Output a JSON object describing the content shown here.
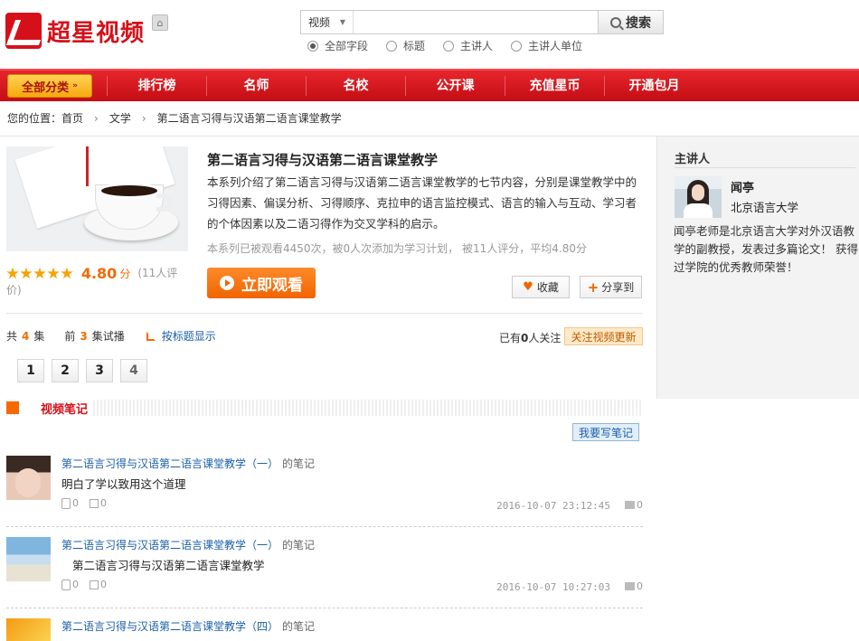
{
  "header": {
    "logo_text": "超星视频",
    "search": {
      "type": "视频",
      "placeholder": "",
      "button": "搜索",
      "filters": [
        "全部字段",
        "标题",
        "主讲人",
        "主讲人单位"
      ],
      "selected_filter": "全部字段"
    }
  },
  "nav": {
    "all": "全部分类",
    "items": [
      "排行榜",
      "名师",
      "名校",
      "公开课",
      "充值星币",
      "开通包月"
    ]
  },
  "breadcrumb": {
    "label": "您的位置：",
    "items": [
      "首页",
      "文学",
      "第二语言习得与汉语第二语言课堂教学"
    ]
  },
  "course": {
    "title": "第二语言习得与汉语第二语言课堂教学",
    "description": "本系列介绍了第二语言习得与汉语第二语言课堂教学的七节内容，分别是课堂教学中的习得因素、偏误分析、习得顺序、克拉申的语言监控模式、语言的输入与互动、学习者的个体因素以及二语习得作为交叉学科的启示。",
    "stats": "本系列已被观看4450次，被0人次添加为学习计划，  被11人评分，平均4.80分",
    "stars": 5,
    "score": "4.80",
    "score_unit": "分",
    "raters": "(11人评价)",
    "watch_button": "立即观看",
    "favorite": "收藏",
    "share": "分享到"
  },
  "episodes": {
    "total_prefix": "共",
    "total": "4",
    "total_suffix": "集",
    "trial_prefix": "前",
    "trial": "3",
    "trial_suffix": "集试播",
    "by_title": "按标题显示",
    "followers_prefix": "已有",
    "followers": "0",
    "followers_suffix": "人关注",
    "follow_button": "关注视频更新",
    "pages": [
      "1",
      "2",
      "3",
      "4"
    ],
    "current_page": "4"
  },
  "notes": {
    "title": "视频笔记",
    "write_button": "我要写笔记",
    "items": [
      {
        "link": "第二语言习得与汉语第二语言课堂教学（一）",
        "of": "的笔记",
        "body": "明白了学以致用这个道理",
        "likes": "0",
        "dislikes": "0",
        "time": "2016-10-07 23:12:45",
        "comments": "0"
      },
      {
        "link": "第二语言习得与汉语第二语言课堂教学（一）",
        "of": "的笔记",
        "body": "第二语言习得与汉语第二语言课堂教学",
        "likes": "0",
        "dislikes": "0",
        "time": "2016-10-07 10:27:03",
        "comments": "0"
      },
      {
        "link": "第二语言习得与汉语第二语言课堂教学（四）",
        "of": "的笔记",
        "body": ""
      }
    ]
  },
  "speaker": {
    "title": "主讲人",
    "name": "闻亭",
    "org": "北京语言大学",
    "bio": "闻亭老师是北京语言大学对外汉语教学的副教授，发表过多篇论文！ 获得过学院的优秀教师荣誉！"
  },
  "colors": {
    "brand_red": "#d6101a",
    "accent_orange": "#f56a00",
    "link_blue": "#1a5fa8"
  }
}
